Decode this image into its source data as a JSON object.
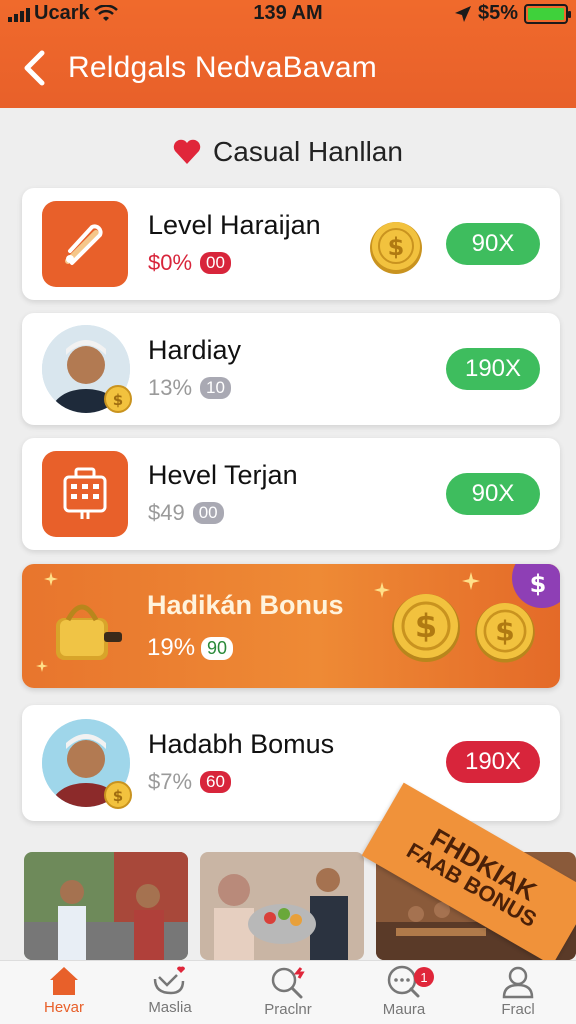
{
  "status_bar": {
    "carrier": "Ucark",
    "time": "139 AM",
    "battery": "$5%"
  },
  "header": {
    "title": "Reldgals NedvaBavam"
  },
  "section": {
    "title": "Casual Hanllan"
  },
  "cards": [
    {
      "title": "Level Haraijan",
      "sub_value": "$0%",
      "chip": "00",
      "pill": "90X"
    },
    {
      "title": "Hardiay",
      "sub_value": "13%",
      "chip": "10",
      "pill": "190X"
    },
    {
      "title": "Hevel Terjan",
      "sub_value": "$49",
      "chip": "00",
      "pill": "90X"
    },
    {
      "title": "Hadabh Bomus",
      "sub_value": "$7%",
      "chip": "60",
      "pill": "190X"
    }
  ],
  "bonus": {
    "title": "Hadikán Bonus",
    "sub_value": "19%",
    "chip": "90"
  },
  "ribbon": {
    "line1": "FHDKIAK",
    "line2": "FAAB BONUS"
  },
  "tabs": [
    {
      "label": "Hevar"
    },
    {
      "label": "Maslia"
    },
    {
      "label": "Praclnr"
    },
    {
      "label": "Maura",
      "badge": "1"
    },
    {
      "label": "Fracl"
    }
  ],
  "colors": {
    "brand": "#e8602a",
    "green": "#3ebd5e",
    "red": "#d8253b"
  }
}
